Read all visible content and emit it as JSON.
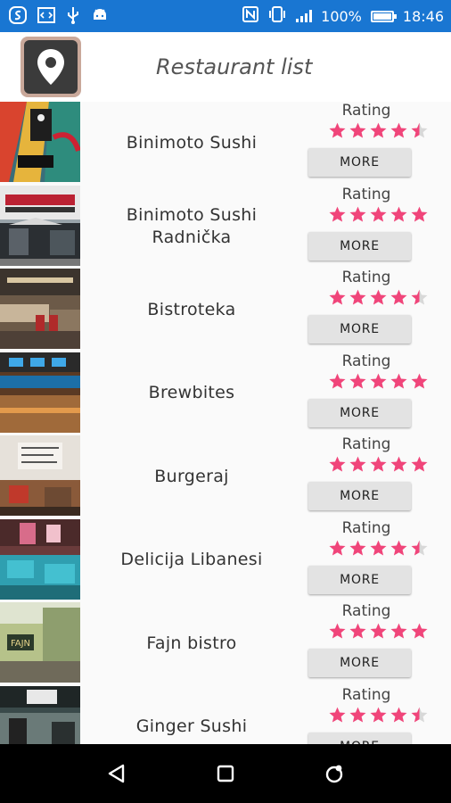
{
  "status_bar": {
    "battery_text": "100%",
    "time": "18:46",
    "icons": [
      "swiftkey-icon",
      "code-icon",
      "usb-icon",
      "android-icon",
      "nfc-icon",
      "vibrate-icon",
      "signal-icon",
      "battery-icon"
    ]
  },
  "header": {
    "title": "Restaurant list",
    "logo_icon": "map-pin-icon"
  },
  "list": {
    "rating_label": "Rating",
    "more_label": "MORE",
    "star_color": "#f0457a",
    "empty_star_color": "#d8d8d8",
    "items": [
      {
        "name": "Binimoto Sushi",
        "rating": 4.5
      },
      {
        "name": "Binimoto Sushi Radnička",
        "rating": 5
      },
      {
        "name": "Bistroteka",
        "rating": 4.5
      },
      {
        "name": "Brewbites",
        "rating": 5
      },
      {
        "name": "Burgeraj",
        "rating": 5
      },
      {
        "name": "Delicija Libanesi",
        "rating": 4.5
      },
      {
        "name": "Fajn bistro",
        "rating": 5
      },
      {
        "name": "Ginger Sushi",
        "rating": 4.5
      }
    ]
  },
  "nav_bar": {
    "icons": [
      "back-icon",
      "home-icon",
      "recents-icon"
    ]
  }
}
